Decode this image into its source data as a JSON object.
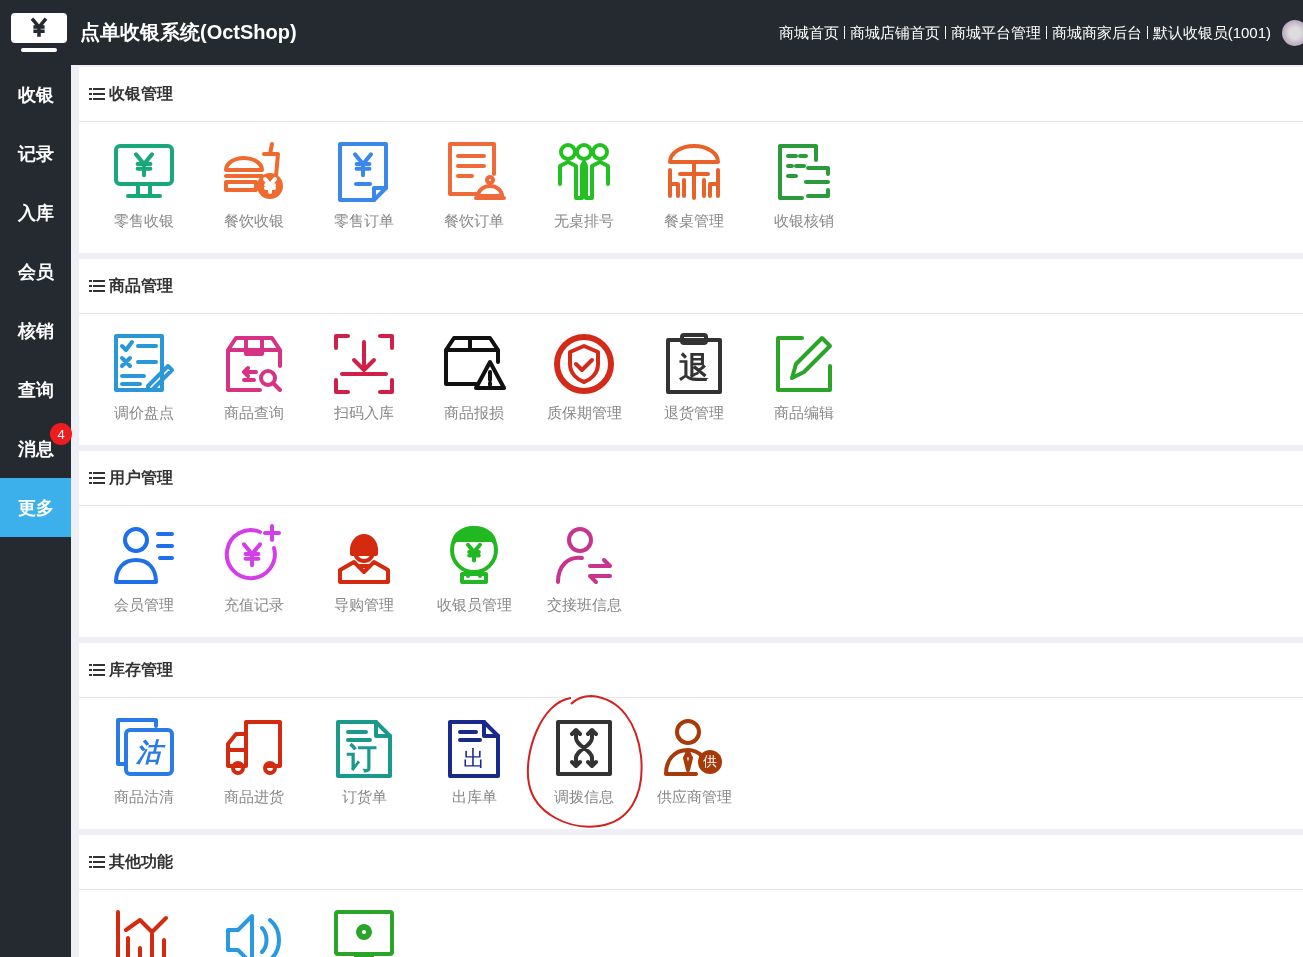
{
  "app": {
    "title": "点单收银系统(OctShop)"
  },
  "top_links": [
    "商城首页",
    "商城店铺首页",
    "商城平台管理",
    "商城商家后台",
    "默认收银员(1001)"
  ],
  "sidebar": {
    "items": [
      {
        "label": "收银",
        "selected": false
      },
      {
        "label": "记录",
        "selected": false
      },
      {
        "label": "入库",
        "selected": false
      },
      {
        "label": "会员",
        "selected": false
      },
      {
        "label": "核销",
        "selected": false
      },
      {
        "label": "查询",
        "selected": false
      },
      {
        "label": "消息",
        "selected": false,
        "badge": "4"
      },
      {
        "label": "更多",
        "selected": true
      }
    ]
  },
  "sections": [
    {
      "title": "收银管理",
      "items": [
        {
          "label": "零售收银",
          "circled": false
        },
        {
          "label": "餐饮收银",
          "circled": false
        },
        {
          "label": "零售订单",
          "circled": false
        },
        {
          "label": "餐饮订单",
          "circled": false
        },
        {
          "label": "无桌排号",
          "circled": false
        },
        {
          "label": "餐桌管理",
          "circled": false
        },
        {
          "label": "收银核销",
          "circled": false
        }
      ]
    },
    {
      "title": "商品管理",
      "items": [
        {
          "label": "调价盘点",
          "circled": false
        },
        {
          "label": "商品查询",
          "circled": false
        },
        {
          "label": "扫码入库",
          "circled": false
        },
        {
          "label": "商品报损",
          "circled": false
        },
        {
          "label": "质保期管理",
          "circled": false
        },
        {
          "label": "退货管理",
          "glyph": "退",
          "circled": false
        },
        {
          "label": "商品编辑",
          "circled": false
        }
      ]
    },
    {
      "title": "用户管理",
      "items": [
        {
          "label": "会员管理",
          "circled": false
        },
        {
          "label": "充值记录",
          "circled": false
        },
        {
          "label": "导购管理",
          "circled": false
        },
        {
          "label": "收银员管理",
          "circled": false
        },
        {
          "label": "交接班信息",
          "circled": false
        }
      ]
    },
    {
      "title": "库存管理",
      "items": [
        {
          "label": "商品沽清",
          "glyph": "沽",
          "circled": false
        },
        {
          "label": "商品进货",
          "circled": false
        },
        {
          "label": "订货单",
          "glyph": "订",
          "circled": false
        },
        {
          "label": "出库单",
          "glyph": "出",
          "circled": false
        },
        {
          "label": "调拨信息",
          "circled": true
        },
        {
          "label": "供应商管理",
          "glyph": "供",
          "circled": false
        }
      ]
    },
    {
      "title": "其他功能",
      "items": [
        {
          "circled": false
        },
        {
          "circled": false
        },
        {
          "circled": false
        }
      ]
    }
  ]
}
